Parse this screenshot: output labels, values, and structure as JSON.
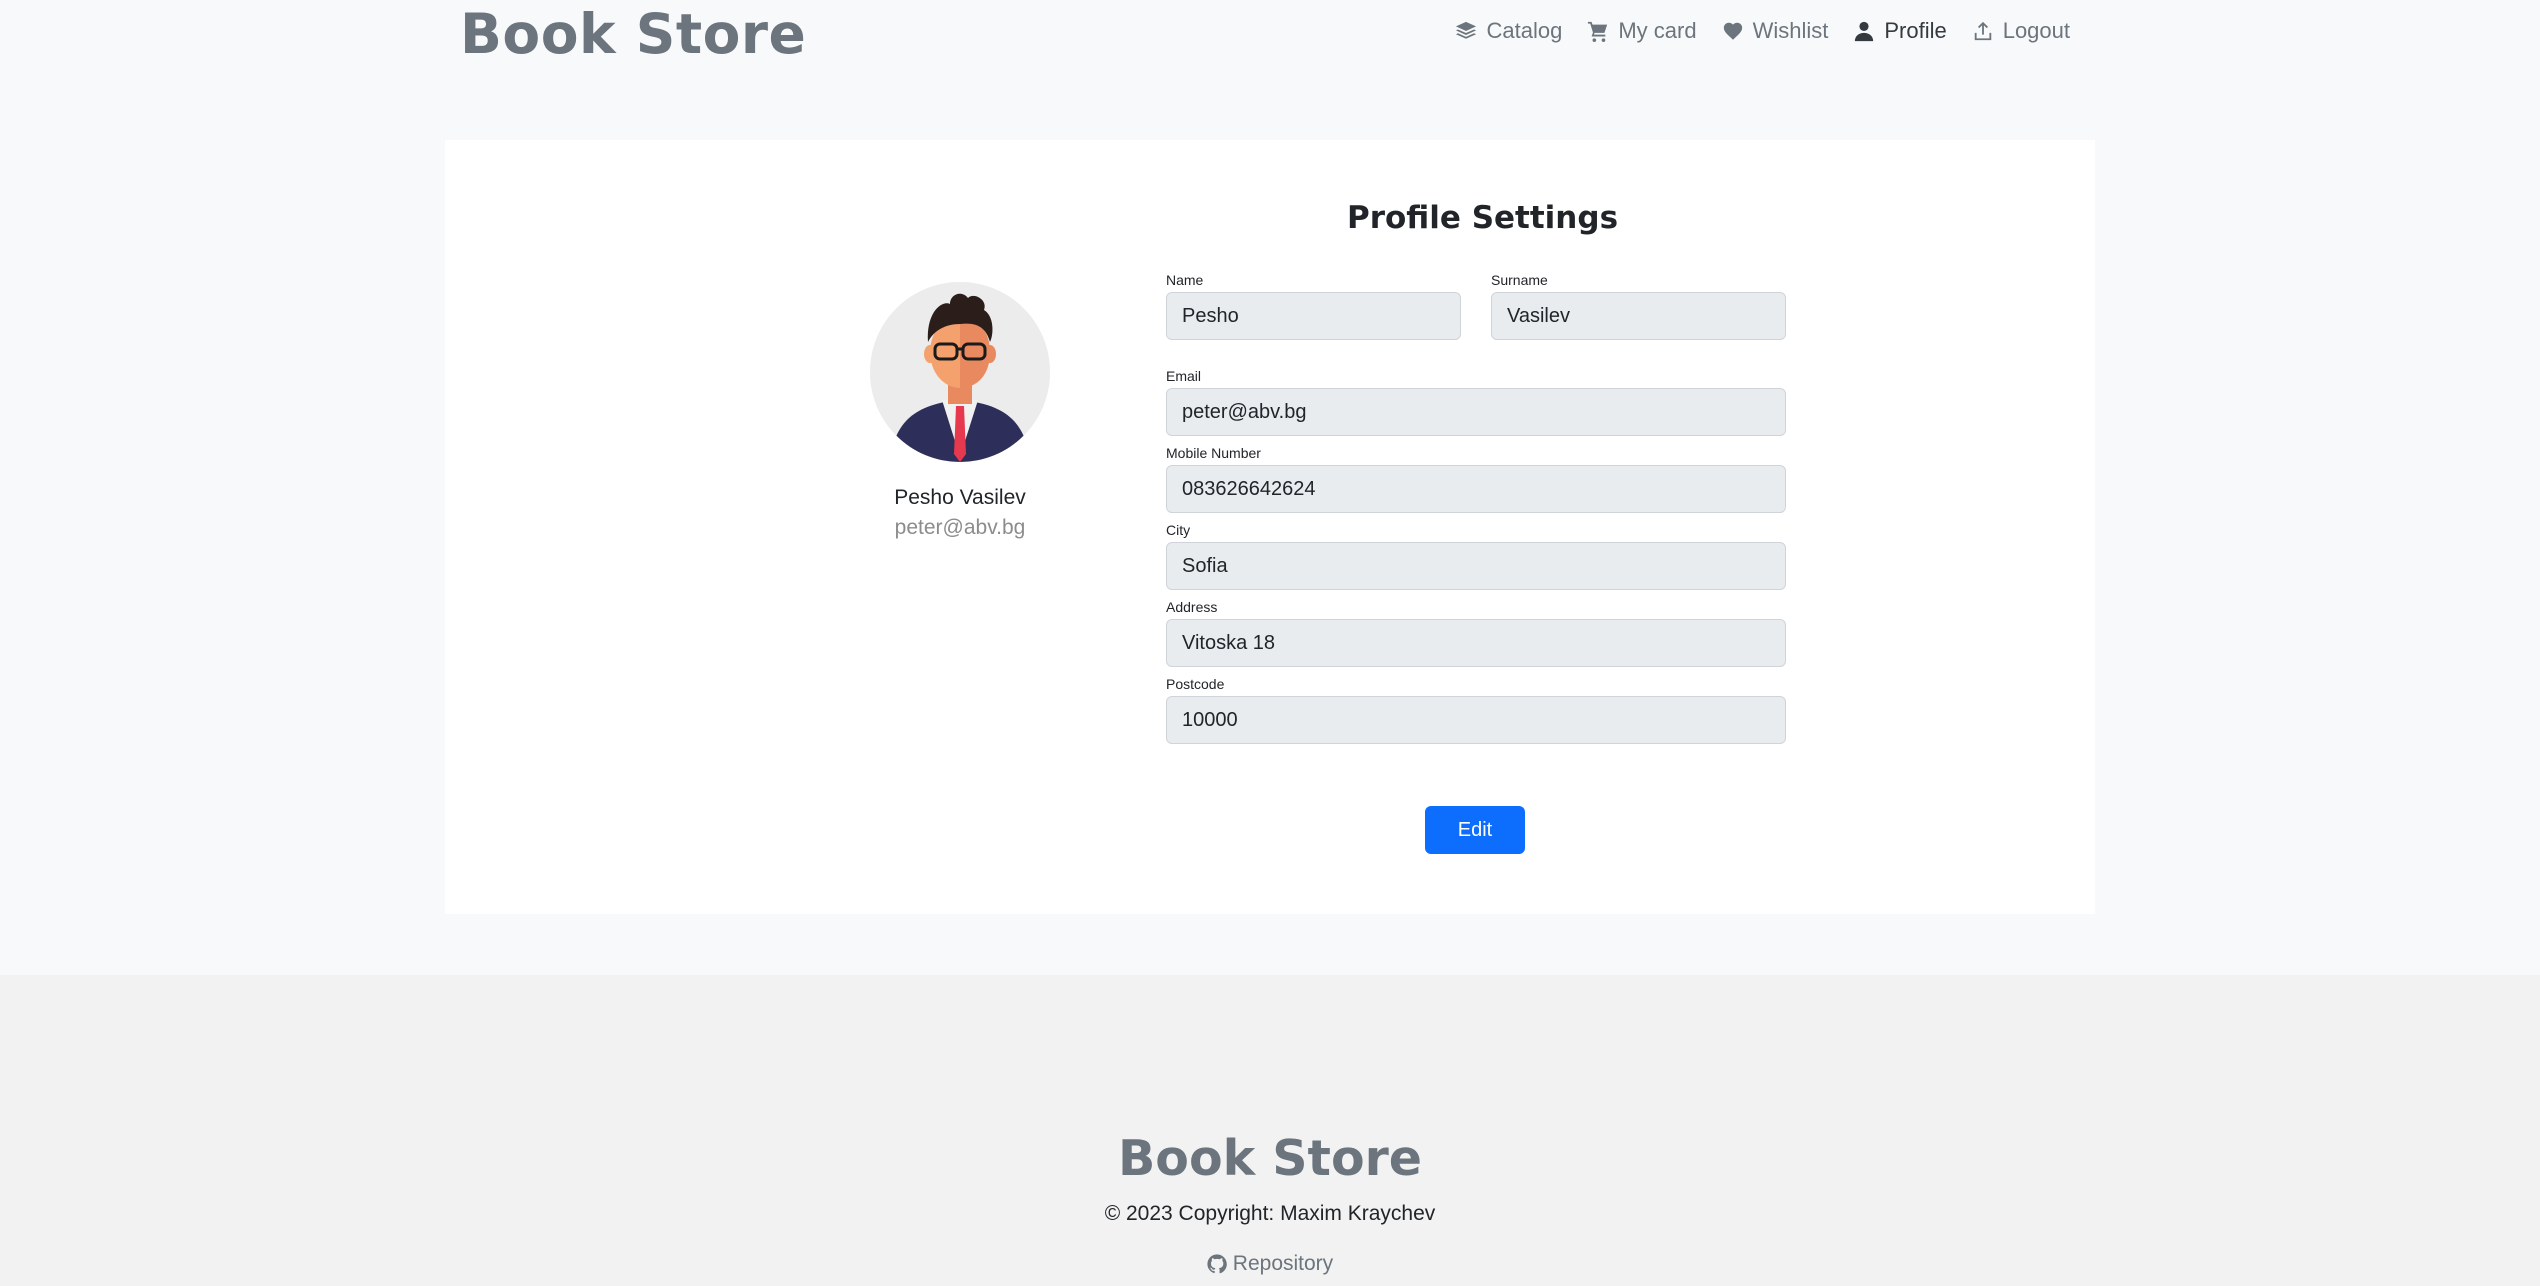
{
  "header": {
    "brand": "Book Store",
    "nav": [
      {
        "label": "Catalog",
        "icon": "layers-icon"
      },
      {
        "label": "My card",
        "icon": "cart-icon"
      },
      {
        "label": "Wishlist",
        "icon": "heart-icon"
      },
      {
        "label": "Profile",
        "icon": "user-icon",
        "active": true
      },
      {
        "label": "Logout",
        "icon": "upload-icon"
      }
    ]
  },
  "profile": {
    "display_name": "Pesho Vasilev",
    "display_email": "peter@abv.bg",
    "title": "Profile Settings",
    "fields": {
      "name": {
        "label": "Name",
        "value": "Pesho"
      },
      "surname": {
        "label": "Surname",
        "value": "Vasilev"
      },
      "email": {
        "label": "Email",
        "value": "peter@abv.bg"
      },
      "mobile": {
        "label": "Mobile Number",
        "value": "083626642624"
      },
      "city": {
        "label": "City",
        "value": "Sofia"
      },
      "address": {
        "label": "Address",
        "value": "Vitoska 18"
      },
      "postcode": {
        "label": "Postcode",
        "value": "10000"
      }
    },
    "edit_label": "Edit"
  },
  "footer": {
    "brand": "Book Store",
    "copyright": "© 2023 Copyright: Maxim Kraychev",
    "repo_label": "Repository"
  },
  "colors": {
    "primary": "#0d6efd",
    "brand": "#6c757d",
    "input_bg": "#e9ecef"
  }
}
